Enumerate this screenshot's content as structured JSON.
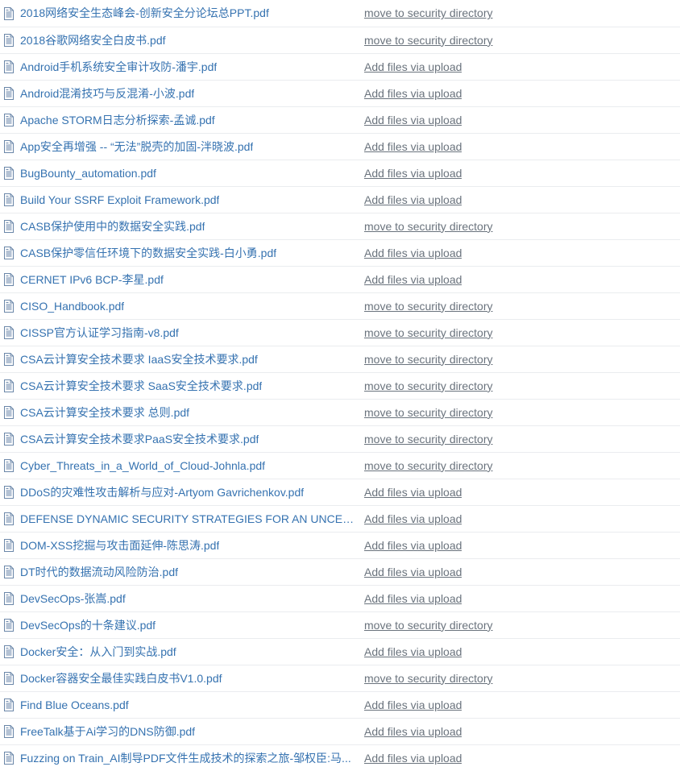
{
  "table": {
    "icon_name": "file-document-icon",
    "columns": [
      "name",
      "commit_message"
    ],
    "colors": {
      "link": "#3572b0",
      "commit_text": "#6a737d",
      "row_border": "#eaecef",
      "icon": "#6a86a8",
      "background": "#ffffff"
    },
    "rows": [
      {
        "name": "2018网络安全生态峰会-创新安全分论坛总PPT.pdf",
        "commit_message": "move to security directory"
      },
      {
        "name": "2018谷歌网络安全白皮书.pdf",
        "commit_message": "move to security directory"
      },
      {
        "name": "Android手机系统安全审计攻防-潘宇.pdf",
        "commit_message": "Add files via upload"
      },
      {
        "name": "Android混淆技巧与反混淆-小波.pdf",
        "commit_message": "Add files via upload"
      },
      {
        "name": "Apache STORM日志分析探索-孟诚.pdf",
        "commit_message": "Add files via upload"
      },
      {
        "name": "App安全再增强 -- “无法”脱壳的加固-泮晓波.pdf",
        "commit_message": "Add files via upload"
      },
      {
        "name": "BugBounty_automation.pdf",
        "commit_message": "Add files via upload"
      },
      {
        "name": "Build Your SSRF Exploit Framework.pdf",
        "commit_message": "Add files via upload"
      },
      {
        "name": "CASB保护使用中的数据安全实践.pdf",
        "commit_message": "move to security directory"
      },
      {
        "name": "CASB保护零信任环境下的数据安全实践-白小勇.pdf",
        "commit_message": "Add files via upload"
      },
      {
        "name": "CERNET IPv6 BCP-李星.pdf",
        "commit_message": "Add files via upload"
      },
      {
        "name": "CISO_Handbook.pdf",
        "commit_message": "move to security directory"
      },
      {
        "name": "CISSP官方认证学习指南-v8.pdf",
        "commit_message": "move to security directory"
      },
      {
        "name": "CSA云计算安全技术要求 IaaS安全技术要求.pdf",
        "commit_message": "move to security directory"
      },
      {
        "name": "CSA云计算安全技术要求 SaaS安全技术要求.pdf",
        "commit_message": "move to security directory"
      },
      {
        "name": "CSA云计算安全技术要求 总则.pdf",
        "commit_message": "move to security directory"
      },
      {
        "name": "CSA云计算安全技术要求PaaS安全技术要求.pdf",
        "commit_message": "move to security directory"
      },
      {
        "name": "Cyber_Threats_in_a_World_of_Cloud-Johnla.pdf",
        "commit_message": "move to security directory"
      },
      {
        "name": "DDoS的灾难性攻击解析与应对-Artyom Gavrichenkov.pdf",
        "commit_message": "Add files via upload"
      },
      {
        "name": "DEFENSE DYNAMIC SECURITY STRATEGIES FOR AN UNCERTAIN ...",
        "commit_message": "Add files via upload"
      },
      {
        "name": "DOM-XSS挖掘与攻击面延伸-陈思涛.pdf",
        "commit_message": "Add files via upload"
      },
      {
        "name": "DT时代的数据流动风险防治.pdf",
        "commit_message": "Add files via upload"
      },
      {
        "name": "DevSecOps-张嵩.pdf",
        "commit_message": "Add files via upload"
      },
      {
        "name": "DevSecOps的十条建议.pdf",
        "commit_message": "move to security directory"
      },
      {
        "name": "Docker安全：从入门到实战.pdf",
        "commit_message": "Add files via upload"
      },
      {
        "name": "Docker容器安全最佳实践白皮书V1.0.pdf",
        "commit_message": "move to security directory"
      },
      {
        "name": "Find Blue Oceans.pdf",
        "commit_message": "Add files via upload"
      },
      {
        "name": "FreeTalk基于Ai学习的DNS防御.pdf",
        "commit_message": "Add files via upload"
      },
      {
        "name": "Fuzzing on Train_AI制导PDF文件生成技术的探索之旅-邹权臣:马...",
        "commit_message": "Add files via upload"
      }
    ]
  }
}
